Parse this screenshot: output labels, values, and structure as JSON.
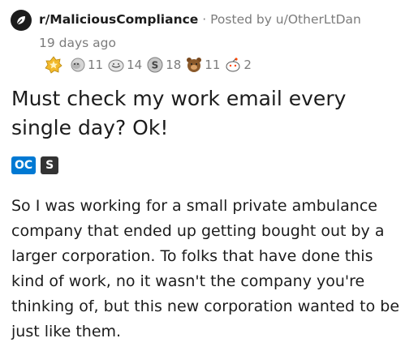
{
  "post": {
    "subreddit": "r/MaliciousCompliance",
    "separator": "·",
    "posted_by": "Posted by u/OtherLtDan",
    "age": "19 days ago",
    "awards": [
      {
        "name": "gold-award",
        "count": ""
      },
      {
        "name": "wholesome-seal-award",
        "count": "11"
      },
      {
        "name": "helpful-award",
        "count": "14"
      },
      {
        "name": "silver-award",
        "count": "18"
      },
      {
        "name": "bear-award",
        "count": "11"
      },
      {
        "name": "snoo-hug-award",
        "count": "2"
      }
    ],
    "title": "Must check my work email every single day? Ok!",
    "flairs": {
      "oc": "OC",
      "s": "S"
    },
    "body": "So I was working for a small private ambulance company that ended up getting bought out by a larger corporation. To folks that have done this kind of work, no it wasn't the company you're thinking of, but this new corporation wanted to be just like them."
  },
  "colors": {
    "oc_flair": "#0079d3",
    "s_flair": "#333333",
    "meta_text": "#7c7c7c",
    "gold": "#f2b92c"
  }
}
